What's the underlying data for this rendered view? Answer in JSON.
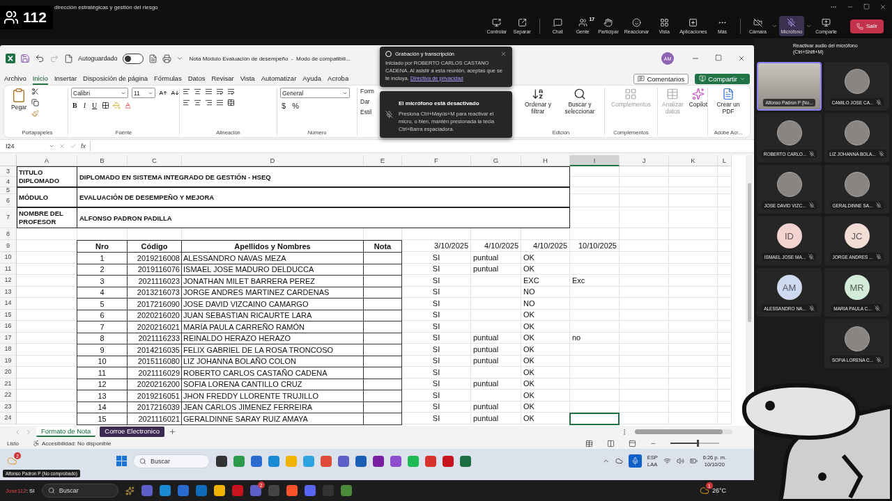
{
  "meeting": {
    "participant_count": "112",
    "title": "dirección estratégicas y gestión del riesgo",
    "toolbar": [
      {
        "kind": "control",
        "label": "Controlar"
      },
      {
        "kind": "popout",
        "label": "Separar"
      },
      {
        "kind": "chat",
        "label": "Chat"
      },
      {
        "kind": "people",
        "label": "Gente",
        "badge": "17"
      },
      {
        "kind": "raise",
        "label": "Participar"
      },
      {
        "kind": "react",
        "label": "Reaccionar"
      },
      {
        "kind": "view",
        "label": "Vista"
      },
      {
        "kind": "apps",
        "label": "Aplicaciones"
      },
      {
        "kind": "more",
        "label": "Más"
      },
      {
        "kind": "camera",
        "label": "Cámara"
      },
      {
        "kind": "mic",
        "label": "Micrófono"
      },
      {
        "kind": "share",
        "label": "Comparte"
      },
      {
        "kind": "leave",
        "label": "Salir"
      }
    ],
    "tooltip": {
      "title": "Reactivar audio del micrófono",
      "shortcut": "(Ctrl+Shift+M)"
    }
  },
  "notifications": {
    "recording": {
      "title": "Grabación y transcripción",
      "body": "Iniciado por ROBERTO CARLOS CASTANO CADENA. Al asistir a esta reunión, aceptas que se te incluya.",
      "link": "Directiva de privacidad"
    },
    "mic": {
      "title": "El micrófono está desactivado",
      "body": "Presiona Ctrl+Mayús+M para reactivar el micro, o bien, mantén presionada la tecla Ctrl+Barra espaciadora."
    }
  },
  "excel": {
    "autosave": {
      "label": "Autoguardado",
      "on": false
    },
    "title": "Nota Módulo Evaluación de desempeño  -  Modo de compatibili...",
    "avatar": "AM",
    "menu": [
      {
        "label": "Archivo",
        "selected": false
      },
      {
        "label": "Inicio",
        "selected": true
      },
      {
        "label": "Insertar",
        "selected": false
      },
      {
        "label": "Disposición de página",
        "selected": false
      },
      {
        "label": "Fórmulas",
        "selected": false
      },
      {
        "label": "Datos",
        "selected": false
      },
      {
        "label": "Revisar",
        "selected": false
      },
      {
        "label": "Vista",
        "selected": false
      },
      {
        "label": "Automatizar",
        "selected": false
      },
      {
        "label": "Ayuda",
        "selected": false
      },
      {
        "label": "Acroba",
        "selected": false
      }
    ],
    "comments": "Comentarios",
    "share": "Compartir",
    "ribbon": {
      "clipboard": {
        "paste": "Pegar",
        "label": "Portapapeles"
      },
      "font": {
        "name": "Calibri",
        "size": "11",
        "buttons": [
          "B",
          "I",
          "U"
        ],
        "label": "Fuente"
      },
      "alignment": {
        "label": "Alineación"
      },
      "number": {
        "format": "General",
        "symbols": [
          "$",
          "%"
        ],
        "label": "Número"
      },
      "styles": [
        "Form",
        "Dar",
        "Estil"
      ],
      "editing": {
        "sort": "Ordenar y filtrar",
        "find": "Buscar y seleccionar",
        "label": "Edición"
      },
      "addins": {
        "button": "Complementos",
        "label": "Complementos"
      },
      "analyze": {
        "label": "Analizar datos",
        "disabled": true
      },
      "copilot": "Copilot",
      "pdf": {
        "button": "Crear un PDF",
        "label": "Adobe Acr..."
      }
    },
    "formula_bar": {
      "cell": "I24",
      "fx": "fx"
    },
    "sheet": {
      "columns": [
        {
          "letter": "A",
          "selected": false
        },
        {
          "letter": "B",
          "selected": false
        },
        {
          "letter": "C",
          "selected": false
        },
        {
          "letter": "D",
          "selected": false
        },
        {
          "letter": "E",
          "selected": false
        },
        {
          "letter": "F",
          "selected": false
        },
        {
          "letter": "G",
          "selected": false
        },
        {
          "letter": "H",
          "selected": false
        },
        {
          "letter": "I",
          "selected": true
        },
        {
          "letter": "J",
          "selected": false
        },
        {
          "letter": "K",
          "selected": false
        },
        {
          "letter": "L",
          "selected": false
        }
      ],
      "row_numbers": [
        "3",
        "4",
        "5",
        "6",
        "7",
        "8",
        "9",
        "10",
        "11",
        "12",
        "13",
        "14",
        "15",
        "16",
        "17",
        "18",
        "19",
        "20",
        "21",
        "22",
        "23",
        "24"
      ],
      "info": [
        {
          "label": "TITULO DIPLOMADO",
          "value": "DIPLOMADO EN SISTEMA INTEGRADO DE GESTIÓN - HSEQ"
        },
        {
          "label": "MÓDULO",
          "value": "EVALUACIÓN DE DESEMPEÑO Y MEJORA"
        },
        {
          "label": "NOMBRE DEL PROFESOR",
          "value": "ALFONSO PADRON PADILLA"
        }
      ],
      "headers": [
        "Nro",
        "Código",
        "Apellidos y Nombres",
        "Nota"
      ],
      "date_headers": [
        "3/10/2025",
        "4/10/2025",
        "4/10/2025",
        "10/10/2025"
      ],
      "rows": [
        {
          "nro": "1",
          "code": "2019216008",
          "name": "ALESSANDRO NAVAS MEZA",
          "marks": {
            "F": "SI",
            "G": "puntual",
            "H": "OK"
          }
        },
        {
          "nro": "2",
          "code": "2019116076",
          "name": "ISMAEL JOSE MADURO DELDUCCA",
          "marks": {
            "F": "SI",
            "G": "puntual",
            "H": "OK"
          }
        },
        {
          "nro": "3",
          "code": "2021116023",
          "name": "JONATHAN MILET BARRERA PEREZ",
          "marks": {
            "F": "SI",
            "H": "EXC",
            "I": "Exc"
          }
        },
        {
          "nro": "4",
          "code": "2013216073",
          "name": "JORGE ANDRES MARTINEZ CARDENAS",
          "marks": {
            "F": "SI",
            "H": "NO"
          }
        },
        {
          "nro": "5",
          "code": "2017216090",
          "name": "JOSE DAVID VIZCAINO CAMARGO",
          "marks": {
            "F": "SI",
            "H": "NO"
          }
        },
        {
          "nro": "6",
          "code": "2020216020",
          "name": "JUAN SEBASTIAN RICAURTE LARA",
          "marks": {
            "F": "SI",
            "H": "OK"
          }
        },
        {
          "nro": "7",
          "code": "2020216021",
          "name": "MARÍA PAULA CARREÑO RAMÓN",
          "marks": {
            "F": "SI",
            "H": "OK"
          }
        },
        {
          "nro": "8",
          "code": "2021116233",
          "name": "REINALDO HERAZO HERAZO",
          "marks": {
            "F": "SI",
            "G": "puntual",
            "H": "OK",
            "I": "no"
          }
        },
        {
          "nro": "9",
          "code": "2014216035",
          "name": "FELIX GABRIEL DE LA ROSA TRONCOSO",
          "marks": {
            "F": "SI",
            "G": "puntual",
            "H": "OK"
          }
        },
        {
          "nro": "10",
          "code": "2015116080",
          "name": "LIZ JOHANNA BOLAÑO COLON",
          "marks": {
            "F": "SI",
            "G": "puntual",
            "H": "OK"
          }
        },
        {
          "nro": "11",
          "code": "2021116029",
          "name": "ROBERTO CARLOS CASTAÑO CADENA",
          "marks": {
            "F": "SI",
            "H": "OK"
          }
        },
        {
          "nro": "12",
          "code": "2020216200",
          "name": "SOFIA LORENA CANTILLO CRUZ",
          "marks": {
            "F": "SI",
            "G": "puntual",
            "H": "OK"
          }
        },
        {
          "nro": "13",
          "code": "2019216051",
          "name": "JHON FREDDY LLORENTE TRUJILLO",
          "marks": {
            "F": "SI",
            "H": "OK"
          }
        },
        {
          "nro": "14",
          "code": "2017216039",
          "name": "JEAN CARLOS JIMENEZ FERREIRA",
          "marks": {
            "F": "SI",
            "G": "puntual",
            "H": "OK"
          }
        },
        {
          "nro": "15",
          "code": "2021116021",
          "name": "GERALDINNE SARAY RUIZ AMAYA",
          "marks": {
            "F": "SI",
            "G": "puntual",
            "H": "OK"
          }
        }
      ]
    },
    "sheet_tabs": [
      {
        "label": "Formato de Nota",
        "selected": true
      },
      {
        "label": "Corroe Electronico",
        "selected": false,
        "color": "#3d2a52"
      }
    ],
    "status": {
      "ready": "Listo",
      "accessibility": "Accesibilidad: No disponible",
      "zoom": {
        "level": 0.55
      }
    }
  },
  "participants": [
    {
      "name": "Alfonso Padron P (No...",
      "kind": "video",
      "muted": false,
      "speaking": true
    },
    {
      "name": "CAMILO JOSE CA...",
      "kind": "photo",
      "muted": true,
      "speaking": false
    },
    {
      "name": "ROBERTO CARLO...",
      "kind": "photo",
      "muted": true,
      "speaking": false
    },
    {
      "name": "LIZ JOHANNA BOLA...",
      "kind": "photo",
      "muted": true,
      "speaking": false
    },
    {
      "name": "JOSE DAVID VIZC...",
      "kind": "photo",
      "muted": true,
      "speaking": false
    },
    {
      "name": "GERALDINNE SA...",
      "kind": "photo",
      "muted": true,
      "speaking": false
    },
    {
      "name": "ISMAEL JOSE MA...",
      "kind": "initials",
      "initials": "ID",
      "color": "#f3d3cf",
      "muted": true,
      "speaking": false
    },
    {
      "name": "JORGE ANDRES ...",
      "kind": "initials",
      "initials": "JC",
      "color": "#f2dcd6",
      "muted": true,
      "speaking": false
    },
    {
      "name": "ALESSANDRO NA...",
      "kind": "initials",
      "initials": "AM",
      "color": "#cfdaf0",
      "muted": true,
      "speaking": false
    },
    {
      "name": "MARIA PAULA C...",
      "kind": "initials",
      "initials": "MR",
      "color": "#d3ecd9",
      "muted": true,
      "speaking": false
    },
    {
      "name": "SOFIA LORENA C...",
      "kind": "photo",
      "muted": true,
      "speaking": false
    }
  ],
  "inner_taskbar": {
    "badge": "2",
    "search": "Buscar",
    "language": [
      "ESP",
      "LAA"
    ],
    "time": "6:26 p. m.",
    "date": "10/10/20"
  },
  "presenter_label": "Alfonso Padron P (No comprobado)",
  "outer_taskbar": {
    "chat": {
      "author": "Jose112",
      "text": ": SI"
    },
    "search": "Buscar",
    "badge": "2",
    "weather_badge": "1",
    "temperature": "26°C"
  }
}
